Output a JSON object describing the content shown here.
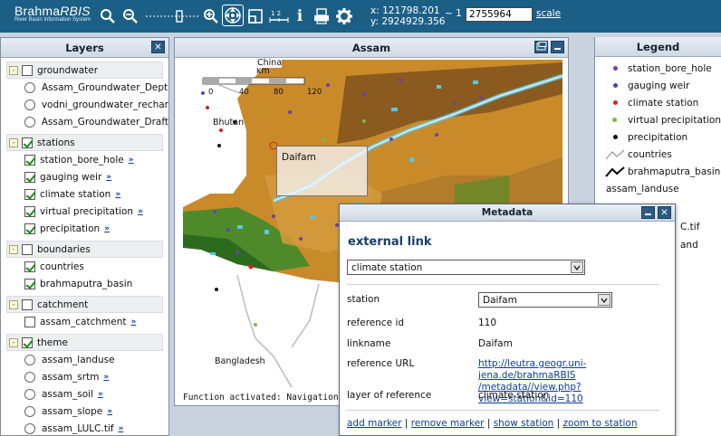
{
  "app": {
    "title": "Brahma",
    "title_italic": "RBIS",
    "subtitle": "River Basin Information System"
  },
  "toolbar": {
    "coord_x": "x: 121798.201",
    "coord_y": "y: 2924929.356",
    "scale_prefix": "~ 1 :",
    "scale_value": "2755964",
    "scale_link": "scale",
    "icons": [
      "zoom-in-icon",
      "zoom-out-icon",
      "zoom-slider",
      "zoom-box-icon",
      "pan-icon",
      "zoom-extent-icon",
      "measure-icon",
      "info-icon",
      "print-icon",
      "settings-icon"
    ]
  },
  "layers": {
    "title": "Layers",
    "close": "✕",
    "groups": [
      {
        "name": "groundwater",
        "checked": false,
        "items": [
          {
            "label": "Assam_Groundwater_Dept",
            "type": "radio"
          },
          {
            "label": "vodni_groundwater_rechar",
            "type": "radio"
          },
          {
            "label": "Assam_Groundwater_Draft",
            "type": "radio"
          }
        ]
      },
      {
        "name": "stations",
        "checked": true,
        "items": [
          {
            "label": "station_bore_hole",
            "type": "check",
            "more": true
          },
          {
            "label": "gauging weir",
            "type": "check",
            "more": true
          },
          {
            "label": "climate station",
            "type": "check",
            "more": true
          },
          {
            "label": "virtual precipitation",
            "type": "check",
            "more": true
          },
          {
            "label": "precipitation",
            "type": "check",
            "more": true
          }
        ]
      },
      {
        "name": "boundaries",
        "checked": false,
        "items": [
          {
            "label": "countries",
            "type": "check"
          },
          {
            "label": "brahmaputra_basin",
            "type": "check"
          }
        ]
      },
      {
        "name": "catchment",
        "checked": false,
        "items": [
          {
            "label": "assam_catchment",
            "type": "uncheck",
            "more": true
          }
        ]
      },
      {
        "name": "theme",
        "checked": true,
        "items": [
          {
            "label": "assam_landuse",
            "type": "radio"
          },
          {
            "label": "assam_srtm",
            "type": "radio",
            "more": true
          },
          {
            "label": "assam_soil",
            "type": "radio",
            "more": true
          },
          {
            "label": "assam_slope",
            "type": "radio",
            "more": true
          },
          {
            "label": "assam_LULC.tif",
            "type": "radio",
            "more": true
          }
        ]
      }
    ],
    "more_glyph": "»"
  },
  "map": {
    "title": "Assam",
    "status": "Function activated: Navigation",
    "scale_unit": "km",
    "scale_ticks": [
      "0",
      "40",
      "80",
      "120"
    ],
    "labels": {
      "bhutan": "Bhutan",
      "bangladesh": "Bangladesh",
      "china": "China"
    },
    "popup_text": "Daifam"
  },
  "legend": {
    "title": "Legend",
    "items": [
      {
        "label": "station_bore_hole",
        "color": "#7a3fb0"
      },
      {
        "label": "gauging weir",
        "color": "#4a3fb8"
      },
      {
        "label": "climate station",
        "color": "#d62020"
      },
      {
        "label": "virtual precipitation",
        "color": "#7dba3a"
      },
      {
        "label": "precipitation",
        "color": "#111111"
      },
      {
        "label": "countries",
        "color": "#9a9a9a"
      },
      {
        "label": "brahmaputra_basin",
        "color": "#000000"
      },
      {
        "label": "assam_landuse",
        "color": ""
      }
    ],
    "partial_1": "C.tif",
    "partial_2": "and"
  },
  "metadata": {
    "title": "Metadata",
    "heading": "external link",
    "layer_select": "climate station",
    "station_label": "station",
    "station_select": "Daifam",
    "rows": [
      {
        "label": "reference id",
        "value": "110"
      },
      {
        "label": "linkname",
        "value": "Daifam"
      },
      {
        "label": "reference URL",
        "value_line1": "http://leutra.geogr.uni-jena.de/brahmaRBIS",
        "value_line2": "/metadata//view.php?view=station&id=110"
      },
      {
        "label": "layer of reference",
        "value": "climate station"
      }
    ],
    "actions": [
      "add marker",
      "remove marker",
      "show station",
      "zoom to station"
    ]
  },
  "colors": {
    "toolbar_bg": "#1c5f86",
    "link": "#0b3c9c",
    "landuse_orange": "#c98a2a",
    "landuse_green": "#4f8a2a",
    "river_blue": "#58c8e8"
  }
}
